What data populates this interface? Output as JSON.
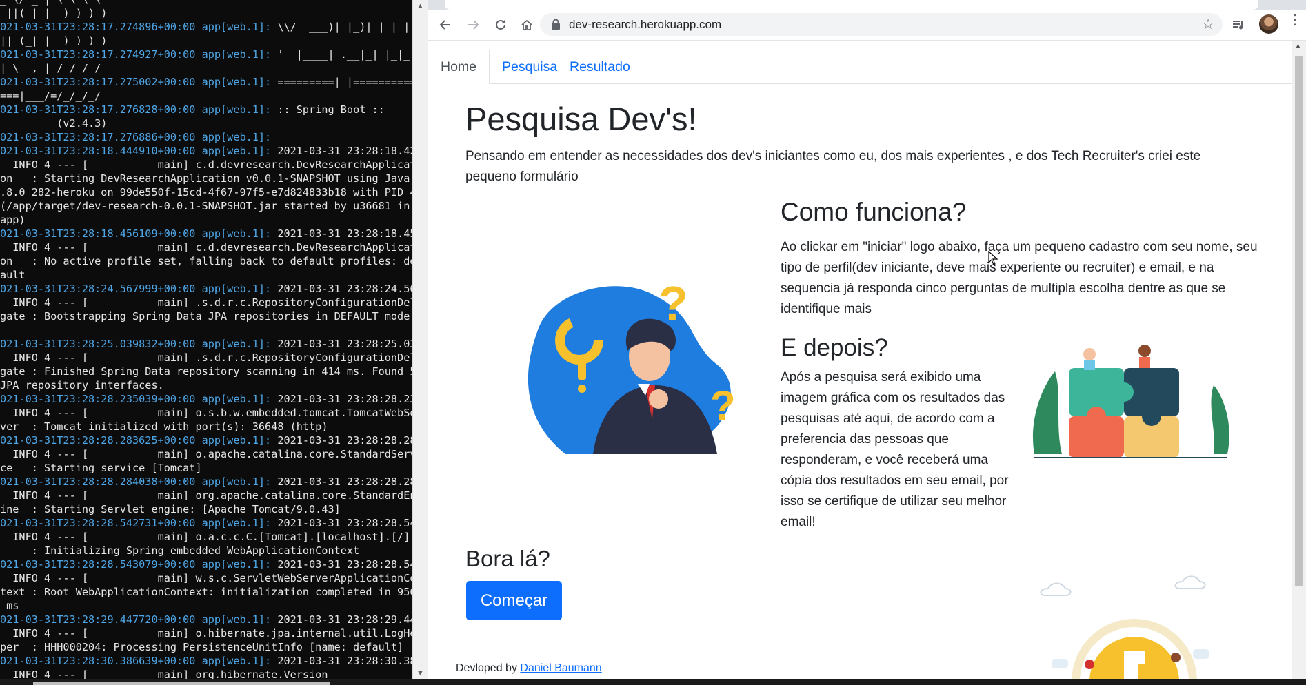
{
  "terminal": {
    "lines": [
      {
        "ts": "",
        "app": "",
        "text": "_ \\/ _ | \\ \\ \\ \\"
      },
      {
        "ts": "",
        "app": "",
        "text": " ||(_| |  ) ) ) )"
      },
      {
        "ts": "021-03-31T23:28:17.274896+00:00",
        "app": "app[web.1]:",
        "text": " \\\\/  ___)| |_)| | | |"
      },
      {
        "ts": "",
        "app": "",
        "text": "|| (_| |  ) ) ) )"
      },
      {
        "ts": "021-03-31T23:28:17.274927+00:00",
        "app": "app[web.1]:",
        "text": " '  |____| .__|_| |_|_|"
      },
      {
        "ts": "",
        "app": "",
        "text": "|_\\__, | / / / /"
      },
      {
        "ts": "021-03-31T23:28:17.275002+00:00",
        "app": "app[web.1]:",
        "text": " =========|_|=========="
      },
      {
        "ts": "",
        "app": "",
        "text": "===|___/=/_/_/_/"
      },
      {
        "ts": "021-03-31T23:28:17.276828+00:00",
        "app": "app[web.1]:",
        "text": " :: Spring Boot ::"
      },
      {
        "ts": "",
        "app": "",
        "text": "         (v2.4.3)"
      },
      {
        "ts": "021-03-31T23:28:17.276886+00:00",
        "app": "app[web.1]:",
        "text": ""
      },
      {
        "ts": "021-03-31T23:28:18.444910+00:00",
        "app": "app[web.1]:",
        "text": " 2021-03-31 23:28:18.42"
      },
      {
        "ts": "",
        "app": "",
        "text": "  INFO 4 --- [           main] c.d.devresearch.DevResearchApplicat"
      },
      {
        "ts": "",
        "app": "",
        "text": "on   : Starting DevResearchApplication v0.0.1-SNAPSHOT using Java"
      },
      {
        "ts": "",
        "app": "",
        "text": ".8.0_282-heroku on 99de550f-15cd-4f67-97f5-e7d824833b18 with PID 4"
      },
      {
        "ts": "",
        "app": "",
        "text": "(/app/target/dev-research-0.0.1-SNAPSHOT.jar started by u36681 in"
      },
      {
        "ts": "",
        "app": "",
        "text": "app)"
      },
      {
        "ts": "021-03-31T23:28:18.456109+00:00",
        "app": "app[web.1]:",
        "text": " 2021-03-31 23:28:18.45"
      },
      {
        "ts": "",
        "app": "",
        "text": "  INFO 4 --- [           main] c.d.devresearch.DevResearchApplicat"
      },
      {
        "ts": "",
        "app": "",
        "text": "on   : No active profile set, falling back to default profiles: de"
      },
      {
        "ts": "",
        "app": "",
        "text": "ault"
      },
      {
        "ts": "021-03-31T23:28:24.567999+00:00",
        "app": "app[web.1]:",
        "text": " 2021-03-31 23:28:24.56"
      },
      {
        "ts": "",
        "app": "",
        "text": "  INFO 4 --- [           main] .s.d.r.c.RepositoryConfigurationDel"
      },
      {
        "ts": "",
        "app": "",
        "text": "gate : Bootstrapping Spring Data JPA repositories in DEFAULT mode."
      },
      {
        "ts": "",
        "app": "",
        "text": ""
      },
      {
        "ts": "021-03-31T23:28:25.039832+00:00",
        "app": "app[web.1]:",
        "text": " 2021-03-31 23:28:25.03"
      },
      {
        "ts": "",
        "app": "",
        "text": "  INFO 4 --- [           main] .s.d.r.c.RepositoryConfigurationDel"
      },
      {
        "ts": "",
        "app": "",
        "text": "gate : Finished Spring Data repository scanning in 414 ms. Found 5"
      },
      {
        "ts": "",
        "app": "",
        "text": "JPA repository interfaces."
      },
      {
        "ts": "021-03-31T23:28:28.235039+00:00",
        "app": "app[web.1]:",
        "text": " 2021-03-31 23:28:28.23"
      },
      {
        "ts": "",
        "app": "",
        "text": "  INFO 4 --- [           main] o.s.b.w.embedded.tomcat.TomcatWebSe"
      },
      {
        "ts": "",
        "app": "",
        "text": "ver  : Tomcat initialized with port(s): 36648 (http)"
      },
      {
        "ts": "021-03-31T23:28:28.283625+00:00",
        "app": "app[web.1]:",
        "text": " 2021-03-31 23:28:28.28"
      },
      {
        "ts": "",
        "app": "",
        "text": "  INFO 4 --- [           main] o.apache.catalina.core.StandardServ"
      },
      {
        "ts": "",
        "app": "",
        "text": "ce   : Starting service [Tomcat]"
      },
      {
        "ts": "021-03-31T23:28:28.284038+00:00",
        "app": "app[web.1]:",
        "text": " 2021-03-31 23:28:28.28"
      },
      {
        "ts": "",
        "app": "",
        "text": "  INFO 4 --- [           main] org.apache.catalina.core.StandardEn"
      },
      {
        "ts": "",
        "app": "",
        "text": "ine  : Starting Servlet engine: [Apache Tomcat/9.0.43]"
      },
      {
        "ts": "021-03-31T23:28:28.542731+00:00",
        "app": "app[web.1]:",
        "text": " 2021-03-31 23:28:28.54"
      },
      {
        "ts": "",
        "app": "",
        "text": "  INFO 4 --- [           main] o.a.c.c.C.[Tomcat].[localhost].[/]"
      },
      {
        "ts": "",
        "app": "",
        "text": "     : Initializing Spring embedded WebApplicationContext"
      },
      {
        "ts": "021-03-31T23:28:28.543079+00:00",
        "app": "app[web.1]:",
        "text": " 2021-03-31 23:28:28.54"
      },
      {
        "ts": "",
        "app": "",
        "text": "  INFO 4 --- [           main] w.s.c.ServletWebServerApplicationCo"
      },
      {
        "ts": "",
        "app": "",
        "text": "text : Root WebApplicationContext: initialization completed in 956"
      },
      {
        "ts": "",
        "app": "",
        "text": " ms"
      },
      {
        "ts": "021-03-31T23:28:29.447720+00:00",
        "app": "app[web.1]:",
        "text": " 2021-03-31 23:28:29.44"
      },
      {
        "ts": "",
        "app": "",
        "text": "  INFO 4 --- [           main] o.hibernate.jpa.internal.util.LogHe"
      },
      {
        "ts": "",
        "app": "",
        "text": "per  : HHH000204: Processing PersistenceUnitInfo [name: default]"
      },
      {
        "ts": "021-03-31T23:28:30.386639+00:00",
        "app": "app[web.1]:",
        "text": " 2021-03-31 23:28:30.38"
      },
      {
        "ts": "",
        "app": "",
        "text": "  INFO 4 --- [           main] org.hibernate.Version"
      }
    ]
  },
  "browser": {
    "url": "dev-research.herokuapp.com",
    "icons": {
      "back": "back-arrow-icon",
      "forward": "forward-arrow-icon",
      "reload": "reload-icon",
      "home": "home-icon",
      "lock": "lock-icon",
      "star": "bookmark-star-icon",
      "media": "media-control-icon",
      "menu": "kebab-menu-icon"
    }
  },
  "nav": {
    "tabs": [
      {
        "label": "Home",
        "active": true
      },
      {
        "label": "Pesquisa",
        "active": false
      },
      {
        "label": "Resultado",
        "active": false
      }
    ]
  },
  "content": {
    "title": "Pesquisa Dev's!",
    "intro": "Pensando em entender as necessidades dos dev's iniciantes como eu, dos mais experientes , e dos Tech Recruiter's criei este pequeno formulário",
    "how_title": "Como funciona?",
    "how_text": "Ao clickar em \"iniciar\" logo abaixo, faça um pequeno cadastro com seu nome, seu tipo de perfil(dev iniciante, deve mais experiente ou recruiter) e email, e na sequencia já responda cinco perguntas de multipla escolha dentre as que se identifique mais",
    "after_title": "E depois?",
    "after_text": "Após a pesquisa será exibido uma imagem gráfica com os resultados das pesquisas até aqui, de acordo com a preferencia das pessoas que responderam, e você receberá uma cópia dos resultados em seu email, por isso se certifique de utilizar seu melhor email!",
    "cta_title": "Bora lá?",
    "cta_button": "Começar"
  },
  "footer": {
    "prefix": "Devloped by ",
    "author": "Daniel Baumann"
  },
  "colors": {
    "primary": "#0d6efd",
    "terminal_bg": "#0c0c0c",
    "terminal_accent": "#4ea6e6"
  }
}
